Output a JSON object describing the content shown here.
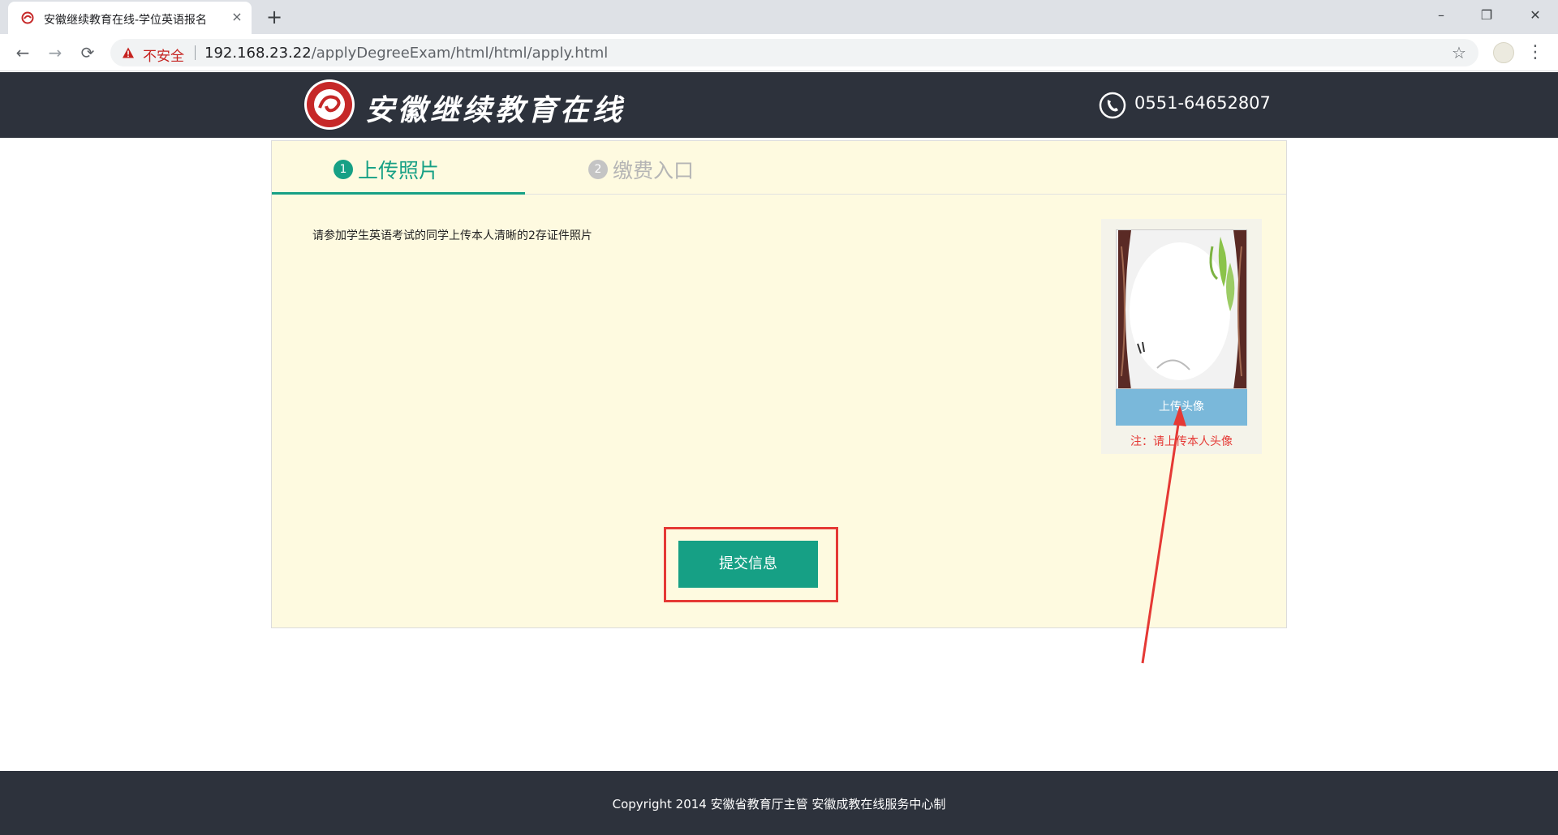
{
  "browser": {
    "tab_title": "安徽继续教育在线-学位英语报名",
    "tab_close": "×",
    "new_tab": "+",
    "window_controls": {
      "minimize": "–",
      "maximize": "❐",
      "close": "✕"
    },
    "nav": {
      "back": "←",
      "forward": "→",
      "reload": "⟳",
      "star": "☆",
      "menu": "⋮"
    },
    "security_label": "不安全",
    "url_host": "192.168.23.22",
    "url_path": "/applyDegreeExam/html/html/apply.html"
  },
  "header": {
    "logo_text": "安徽继续教育在线",
    "phone": "0551-64652807",
    "colors": {
      "background": "#2d323c"
    }
  },
  "steps": [
    {
      "number": "1",
      "label": "上传照片",
      "active": true
    },
    {
      "number": "2",
      "label": "缴费入口",
      "active": false
    }
  ],
  "main": {
    "instruction": "请参加学生英语考试的同学上传本人清晰的2存证件照片",
    "upload_button": "上传头像",
    "upload_note": "注：请上传本人头像",
    "submit_button": "提交信息",
    "colors": {
      "accent": "#16a085",
      "panel": "#fefae0",
      "highlight": "#e53935",
      "upload": "#7ab8da"
    }
  },
  "footer": {
    "copyright": "Copyright 2014 安徽省教育厅主管 安徽成教在线服务中心制"
  }
}
